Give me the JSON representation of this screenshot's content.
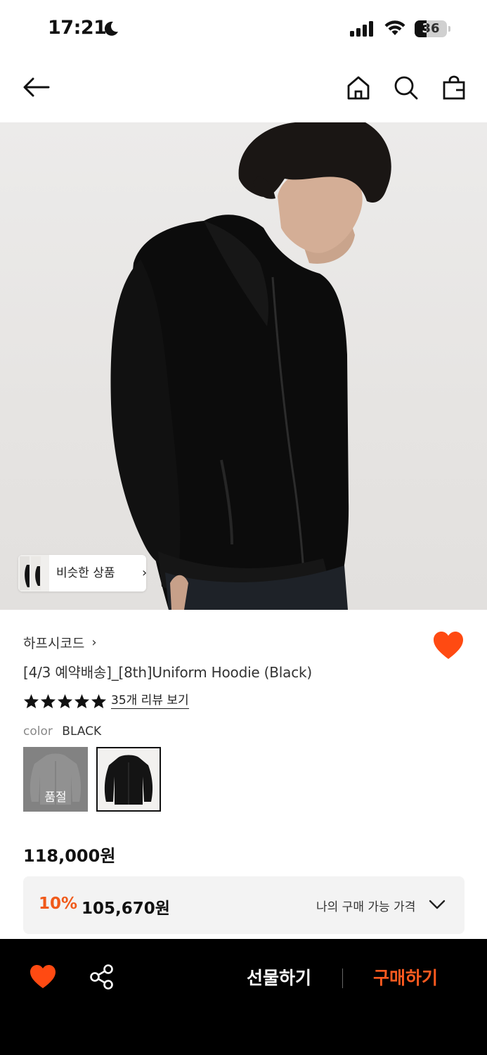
{
  "status_bar": {
    "time": "17:21",
    "battery": "36",
    "battery_level": 0.36
  },
  "nav": {
    "back_icon": "arrow-left-icon",
    "home_icon": "home-icon",
    "search_icon": "search-icon",
    "cart_icon": "shopping-bag-icon"
  },
  "hero": {
    "similar_label": "비슷한 상품",
    "similar_chevron": "›"
  },
  "product": {
    "brand": "하프시코드",
    "brand_chevron": "›",
    "title": "[4/3 예약배송]_[8th]Uniform Hoodie (Black)",
    "rating_stars": 5,
    "review_link": "35개 리뷰 보기",
    "color_label": "color",
    "color_value": "BLACK",
    "swatches": [
      {
        "name": "gray",
        "status": "품절"
      },
      {
        "name": "black",
        "status": ""
      }
    ],
    "price": "118,000원",
    "discount": {
      "rate": "10%",
      "price": "105,670원",
      "note": "나의 구매 가능 가격"
    }
  },
  "bottom_bar": {
    "gift_label": "선물하기",
    "buy_label": "구매하기"
  },
  "colors": {
    "accent": "#ff5a1f",
    "heart": "#ff4a12",
    "bottom_bar_bg": "#000000"
  }
}
